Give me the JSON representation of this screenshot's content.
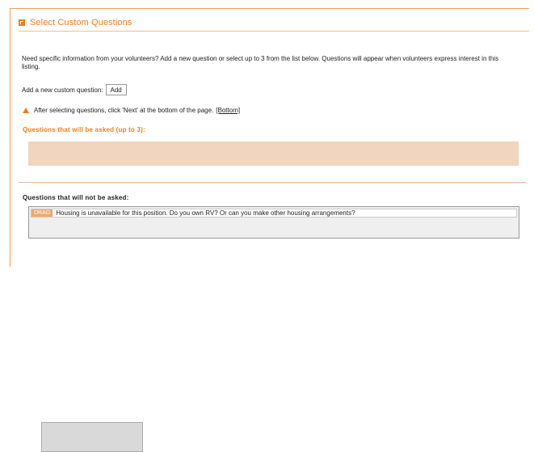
{
  "panel": {
    "title": "Select Custom Questions",
    "intro": "Need specific information from your volunteers? Add a new question or select up to 3 from the list below. Questions will appear when volunteers express interest in this listing.",
    "add_label": "Add a new custom question:",
    "add_button": "Add",
    "warning_text": "After selecting questions, click 'Next' at the bottom of the page.",
    "warning_link": "[Bottom]",
    "asked_heading": "Questions that will be asked (up to 3):",
    "not_asked_heading": "Questions that will not be asked:",
    "questions": [
      {
        "drag_label": "DRAG",
        "text": "Housing is unavailable for this position. Do you own RV? Or can you make other housing arrangements?"
      }
    ]
  },
  "colors": {
    "accent": "#ef7f1a",
    "drop_zone": "#f2d5be",
    "drag_tag": "#f0a86a"
  },
  "icons": {
    "header": "square-bullet-icon",
    "warning": "warning-triangle-icon"
  }
}
